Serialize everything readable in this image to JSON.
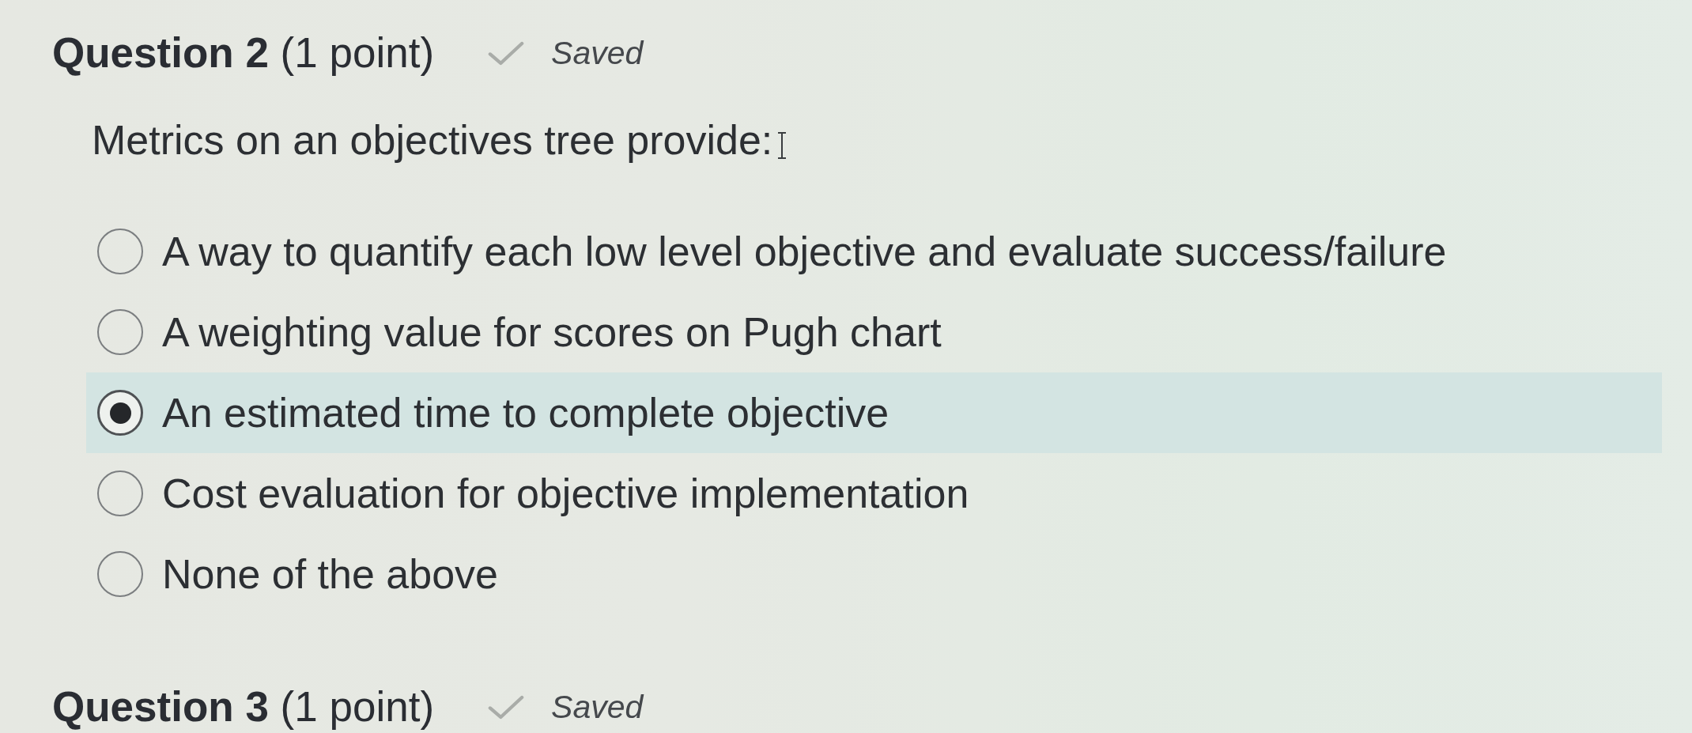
{
  "questions": [
    {
      "heading": "**Question 2** (1 point)",
      "saved": true,
      "status": "Saved",
      "prompt": "Metrics on an objectives tree provide:",
      "options": [
        {
          "label": "A way to quantify each low level objective and evaluate success/failure",
          "selected": false
        },
        {
          "label": "A weighting value for scores on Pugh chart",
          "selected": false
        },
        {
          "label": "An estimated time to complete objective",
          "selected": true
        },
        {
          "label": "Cost evaluation for objective implementation",
          "selected": false
        },
        {
          "label": "None of the above",
          "selected": false
        }
      ]
    },
    {
      "heading": "**Question 3** (1 point)",
      "saved": true,
      "status": "Saved"
    }
  ]
}
